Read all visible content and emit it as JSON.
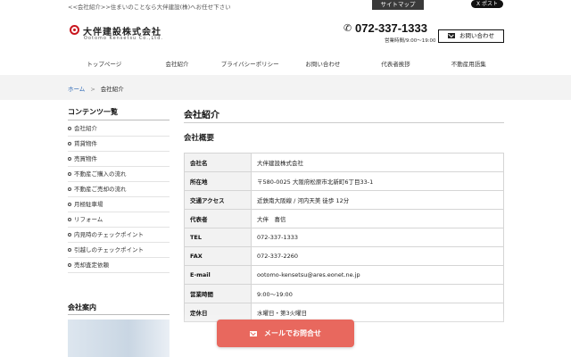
{
  "topbar": {
    "tagline": "<<会社紹介>>住まいのことなら大伴建設(株)へお任せ下さい",
    "sitemap_label": "サイトマップ",
    "x_post_label": "X ポスト"
  },
  "header": {
    "logo_name": "大伴建設株式会社",
    "logo_sub": "Ootomo Kensetsu Co.,Ltd.",
    "phone": "072-337-1333",
    "hours": "営業時間/9:00〜19:00",
    "contact_label": "お問い合わせ"
  },
  "nav": [
    {
      "label": "トップページ"
    },
    {
      "label": "会社紹介"
    },
    {
      "label": "プライバシーポリシー"
    },
    {
      "label": "お問い合わせ"
    },
    {
      "label": "代表者挨拶"
    },
    {
      "label": "不動産用語集"
    }
  ],
  "breadcrumb": {
    "home": "ホーム",
    "separator": ">",
    "current": "会社紹介"
  },
  "sidebar": {
    "title": "コンテンツ一覧",
    "items": [
      {
        "label": "会社紹介"
      },
      {
        "label": "賃貸物件"
      },
      {
        "label": "売買物件"
      },
      {
        "label": "不動産ご購入の流れ"
      },
      {
        "label": "不動産ご売却の流れ"
      },
      {
        "label": "月極駐車場"
      },
      {
        "label": "リフォーム"
      },
      {
        "label": "内見時のチェックポイント"
      },
      {
        "label": "引越しのチェックポイント"
      },
      {
        "label": "売却査定依頼"
      }
    ],
    "section2_title": "会社案内"
  },
  "main": {
    "title": "会社紹介",
    "subtitle": "会社概要",
    "rows": [
      {
        "label": "会社名",
        "value": "大伴建設株式会社"
      },
      {
        "label": "所在地",
        "value": "〒580-0025 大阪府松原市北新町6丁目33-1"
      },
      {
        "label": "交通アクセス",
        "value": "近鉄南大阪線 / 河内天美 徒歩 12分"
      },
      {
        "label": "代表者",
        "value": "大伴　喜信"
      },
      {
        "label": "TEL",
        "value": "072-337-1333"
      },
      {
        "label": "FAX",
        "value": "072-337-2260"
      },
      {
        "label": "E-mail",
        "value": "ootomo-kensetsu@ares.eonet.ne.jp"
      },
      {
        "label": "営業時間",
        "value": "9:00〜19:00"
      },
      {
        "label": "定休日",
        "value": "水曜日・第3火曜日"
      }
    ]
  },
  "float_button": {
    "label": "メールでお問合せ"
  },
  "colors": {
    "accent": "#e8685e",
    "logo_red": "#c9161e",
    "link_blue": "#2a66b5"
  }
}
